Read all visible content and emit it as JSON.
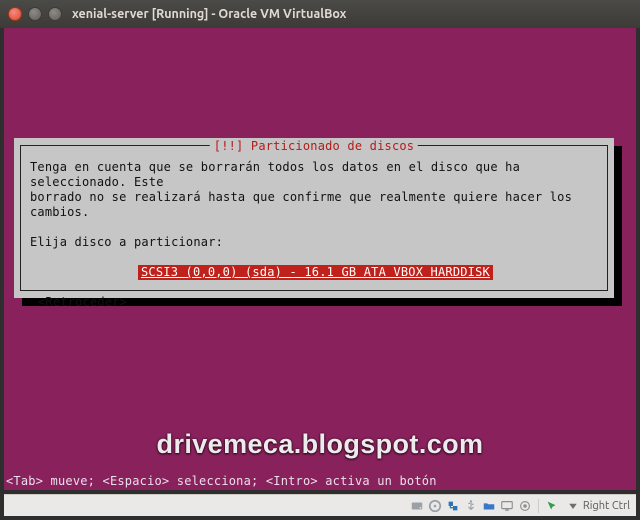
{
  "window": {
    "title": "xenial-server [Running] - Oracle VM VirtualBox"
  },
  "dialog": {
    "title": "[!!] Particionado de discos",
    "warning_line1": "Tenga en cuenta que se borrarán todos los datos en el disco que ha seleccionado. Este",
    "warning_line2": "borrado no se realizará hasta que confirme que realmente quiere hacer los cambios.",
    "prompt": "Elija disco a particionar:",
    "selected_disk": "SCSI3 (0,0,0) (sda) - 16.1 GB ATA VBOX HARDDISK",
    "back": "<Retroceder>"
  },
  "helpbar": "<Tab> mueve; <Espacio> selecciona; <Intro> activa un botón",
  "watermark": "drivemeca.blogspot.com",
  "statusbar": {
    "hostkey": "Right Ctrl"
  }
}
